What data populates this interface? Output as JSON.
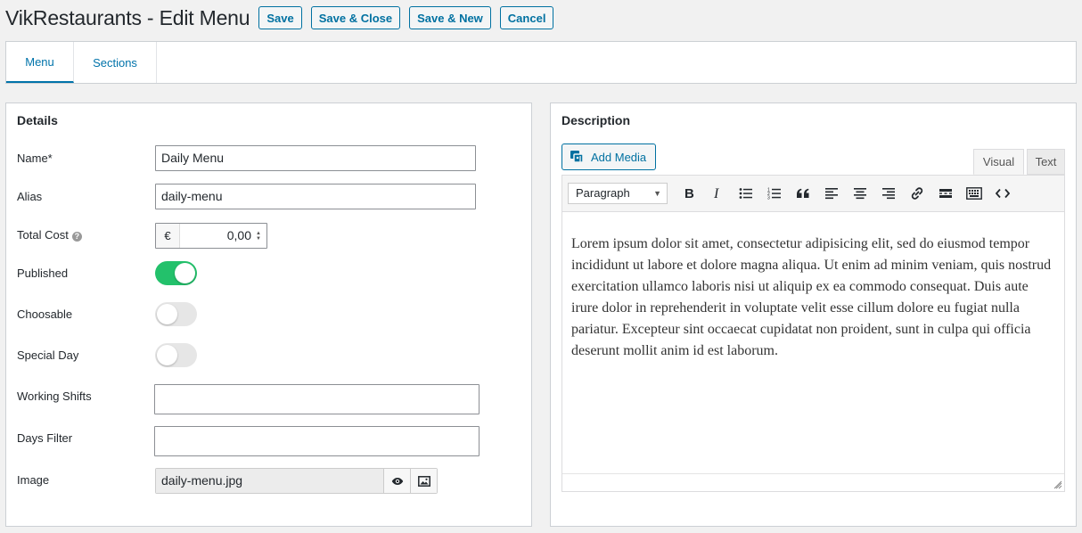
{
  "header": {
    "title": "VikRestaurants - Edit Menu",
    "buttons": {
      "save": "Save",
      "save_close": "Save & Close",
      "save_new": "Save & New",
      "cancel": "Cancel"
    }
  },
  "tabs": [
    {
      "label": "Menu",
      "active": true
    },
    {
      "label": "Sections",
      "active": false
    }
  ],
  "details": {
    "title": "Details",
    "name": {
      "label": "Name*",
      "value": "Daily Menu"
    },
    "alias": {
      "label": "Alias",
      "value": "daily-menu"
    },
    "total_cost": {
      "label": "Total Cost",
      "currency": "€",
      "value": "0,00"
    },
    "published": {
      "label": "Published",
      "on": true
    },
    "choosable": {
      "label": "Choosable",
      "on": false
    },
    "special_day": {
      "label": "Special Day",
      "on": false
    },
    "working_shifts": {
      "label": "Working Shifts",
      "value": ""
    },
    "days_filter": {
      "label": "Days Filter",
      "value": ""
    },
    "image": {
      "label": "Image",
      "value": "daily-menu.jpg"
    }
  },
  "description": {
    "title": "Description",
    "add_media": "Add Media",
    "tabs": {
      "visual": "Visual",
      "text": "Text"
    },
    "format": "Paragraph",
    "content": "Lorem ipsum dolor sit amet, consectetur adipisicing elit, sed do eiusmod tempor incididunt ut labore et dolore magna aliqua. Ut enim ad minim veniam, quis nostrud exercitation ullamco laboris nisi ut aliquip ex ea commodo consequat. Duis aute irure dolor in reprehenderit in voluptate velit esse cillum dolore eu fugiat nulla pariatur. Excepteur sint occaecat cupidatat non proident, sunt in culpa qui officia deserunt mollit anim id est laborum."
  },
  "colors": {
    "accent": "#0071a1",
    "toggle_on": "#23c16b",
    "toggle_off": "#e6e6e6"
  }
}
